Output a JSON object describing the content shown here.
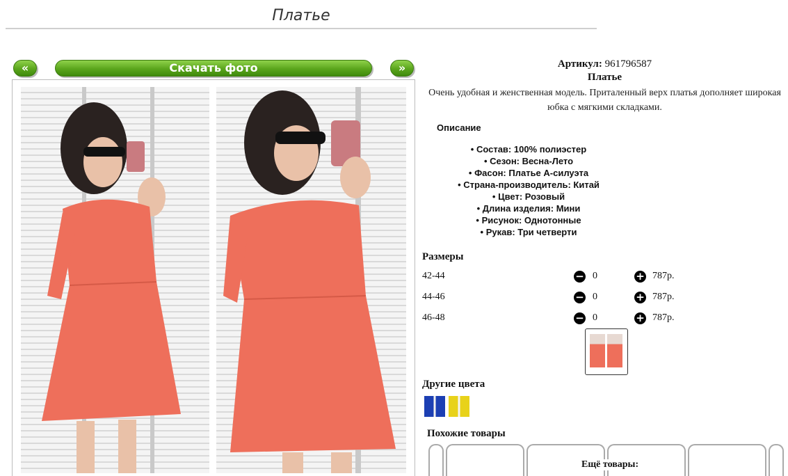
{
  "page": {
    "title": "Платье"
  },
  "gallery": {
    "prev_label": "«",
    "download_label": "Скачать фото",
    "next_label": "»"
  },
  "product": {
    "article_label": "Артикул:",
    "article_value": "961796587",
    "name": "Платье",
    "description": "Очень удобная и женственная модель. Приталенный верх платья дополняет широкая юбка с мягкими складками.",
    "details_heading": "Описание",
    "features": [
      "Состав: 100% полиэстер",
      "Сезон: Весна-Лето",
      "Фасон: Платье А-силуэта",
      "Страна-производитель: Китай",
      "Цвет: Розовый",
      "Длина изделия: Мини",
      "Рисунок: Однотонные",
      "Рукав: Три четверти"
    ]
  },
  "sizes": {
    "heading": "Размеры",
    "rows": [
      {
        "size": "42-44",
        "qty": "0",
        "price": "787р."
      },
      {
        "size": "44-46",
        "qty": "0",
        "price": "787р."
      },
      {
        "size": "46-48",
        "qty": "0",
        "price": "787р."
      }
    ]
  },
  "other_colors": {
    "heading": "Другие цвета"
  },
  "similar": {
    "heading": "Похожие товары",
    "more_label": "Ещё товары:"
  },
  "colors": {
    "accent_green": "#5aa51c",
    "dress": "#ee6f5b"
  }
}
